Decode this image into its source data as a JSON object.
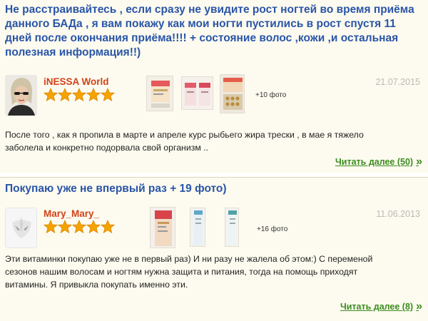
{
  "reviews": [
    {
      "title": "Не расстраивайтесь , если сразу не увидите рост ногтей во время приёма данного БАДа , я вам покажу как мои ногти пустились в рост спустя 11 дней после окончания приёма!!!! + состояние волос ,кожи ,и остальная полезная информация!!)",
      "author": "iNESSA World",
      "date": "21.07.2015",
      "rating": 5,
      "more_photos": "+10 фото",
      "excerpt": "После того , как я пропила в марте и апреле курс рыбьего жира трески , в мае я тяжело заболела и конкретно подорвала свой организм ..",
      "read_more": "Читать далее (50)",
      "chevron": "»"
    },
    {
      "title": "Покупаю уже не впервый раз + 19 фото)",
      "author": "Mary_Mary_",
      "date": "11.06.2013",
      "rating": 5,
      "more_photos": "+16 фото",
      "excerpt": "Эти витаминки покупаю уже не в первый раз) И ни разу не жалела об этом:) С переменой сезонов нашим волосам и ногтям нужна защита и питания, тогда на помощь приходят витамины. Я привыкла покупать именно эти.",
      "read_more": "Читать далее (8)",
      "chevron": "»"
    }
  ],
  "colors": {
    "title": "#2a55a8",
    "author": "#d1421a",
    "date": "#b9b9b9",
    "read_more": "#3a8c1e",
    "star": "#f5a300",
    "background": "#fdfbef"
  }
}
